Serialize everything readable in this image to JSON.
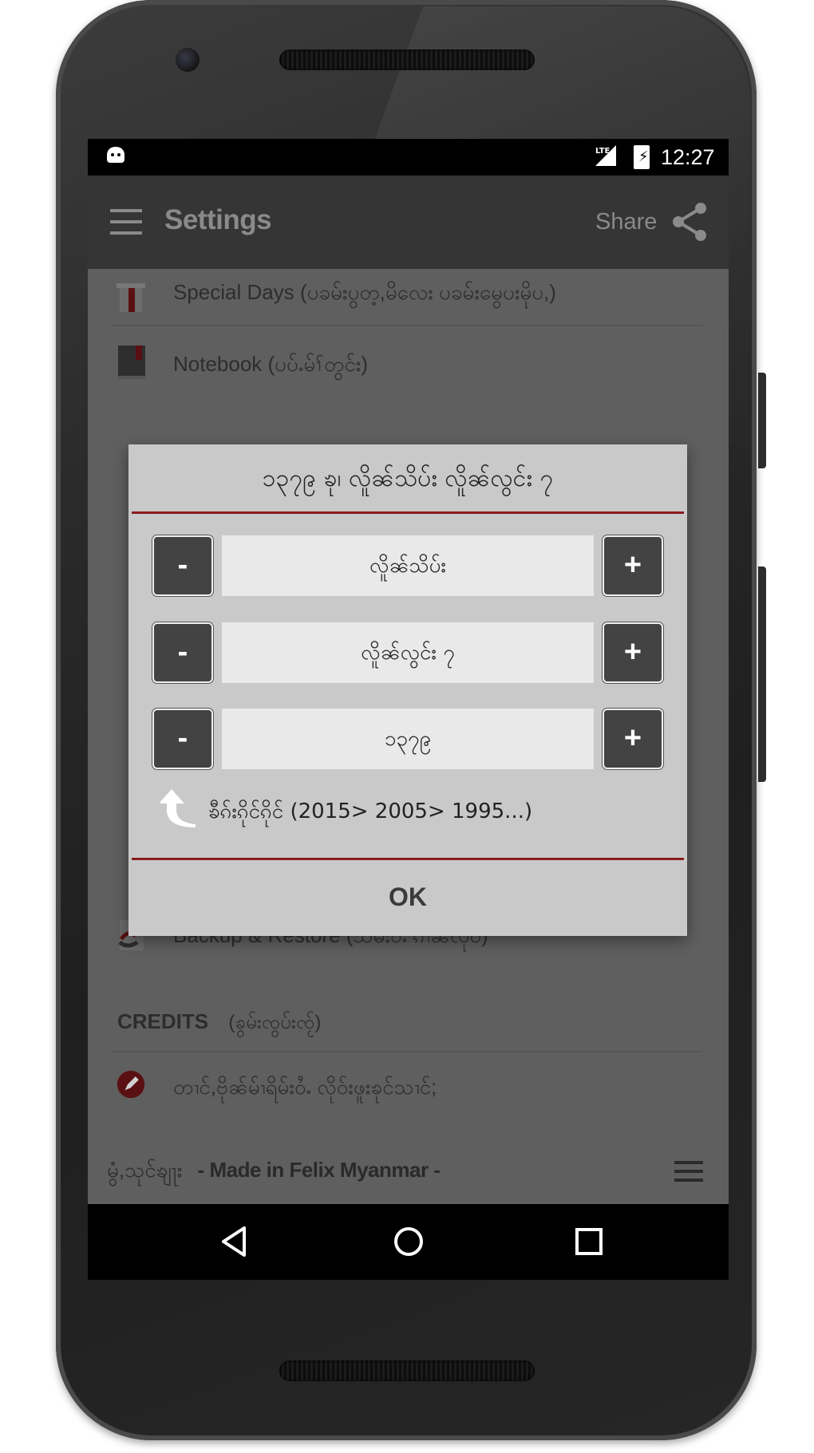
{
  "status_bar": {
    "time": "12:27",
    "icons": [
      "android-debug-icon",
      "lte-signal-icon",
      "battery-charging-icon"
    ]
  },
  "app_bar": {
    "title": "Settings",
    "share_label": "Share"
  },
  "settings_list": {
    "special_days": "Special Days  (ပခမ်းပွတ့,မိလေး ပခမ်းမွေပးမိုပ,)",
    "notebook": "Notebook  (ပပ်ႉမ်ၢ်တွင်း)",
    "backup": "Backup & Restore  (သိမ်းဝႆႉ ၵၢၼ်လိုဝ်)",
    "credits_heading": "CREDITS",
    "credits_subheading": "(ၶွမ်းၸွပ်းၸႂ်)",
    "credits_item": "တၢင်,ဗိုၼ်မ်ၢရိမ်းဝႆႉ လိုဝ်းဖူးၶုင်သၢင်;",
    "footer_myanmar": "မွံ,သုင်ၶျႃး",
    "footer_made_in": "- Made in Felix Myanmar -"
  },
  "dialog": {
    "title": "၁၃၇၉ ၶု၊ လိူၼ်သိပ်း လိူၼ်လွင်း ၇",
    "month_value": "လိူၼ်သိပ်း",
    "day_value": "လိူၼ်လွင်း ၇",
    "year_value": "၁၃၇၉",
    "minus_label": "-",
    "plus_label": "+",
    "cycle_text": "ၶီၵ်းၵိုင်ၵိုင် (2015> 2005> 1995...)",
    "ok_label": "OK"
  },
  "colors": {
    "accent_red": "#8b1b1f",
    "dialog_bg": "#c9c9c9",
    "button_dark": "#434343"
  }
}
